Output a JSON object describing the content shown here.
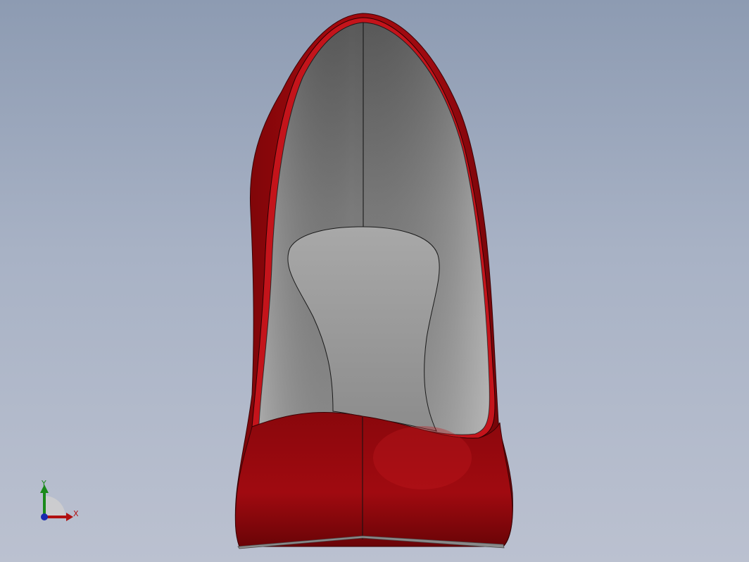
{
  "viewport": {
    "background_top": "#8d9bb2",
    "background_bottom": "#bbc1d0"
  },
  "model": {
    "object": "high-heel-shoe",
    "view": "front",
    "body_color": "#a40a0f",
    "lining_color": "#8c8c8c",
    "insole_color": "#9a9a9a",
    "sole_color": "#7a7a7a"
  },
  "triad": {
    "x_label": "X",
    "y_label": "Y",
    "x_color": "#b01010",
    "y_color": "#1a8a1a",
    "z_color": "#1a2ab0"
  }
}
